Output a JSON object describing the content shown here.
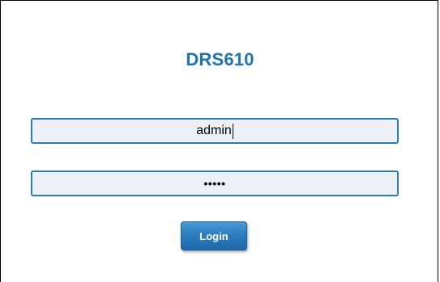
{
  "title": "DRS610",
  "username": {
    "value": "admin"
  },
  "password": {
    "masked_value": "•••••"
  },
  "login_button": {
    "label": "Login"
  },
  "colors": {
    "title": "#1f74b0",
    "field_border": "#2a7db4",
    "field_background": "#edf1f7",
    "button": "#2a7bbe"
  }
}
